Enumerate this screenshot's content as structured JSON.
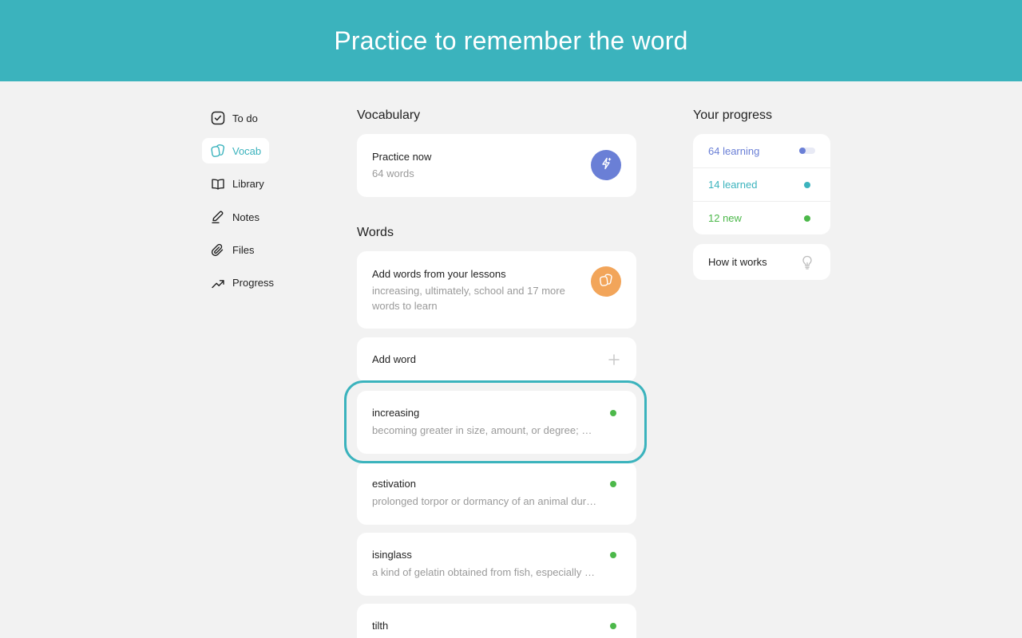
{
  "banner": {
    "title": "Practice to remember the word"
  },
  "nav": {
    "items": [
      {
        "label": "To do",
        "icon": "checkbox-icon"
      },
      {
        "label": "Vocab",
        "icon": "cards-icon",
        "active": true
      },
      {
        "label": "Library",
        "icon": "book-icon"
      },
      {
        "label": "Notes",
        "icon": "pencil-icon"
      },
      {
        "label": "Files",
        "icon": "paperclip-icon"
      },
      {
        "label": "Progress",
        "icon": "trend-up-icon"
      }
    ]
  },
  "vocabulary": {
    "title": "Vocabulary",
    "practice": {
      "title": "Practice now",
      "subtitle": "64 words",
      "icon": "lightning-icon",
      "color": "#6a7fd6"
    }
  },
  "words": {
    "title": "Words",
    "add_from_lessons": {
      "title": "Add words from your lessons",
      "subtitle": "increasing, ultimately, school and 17 more words to learn",
      "icon": "cards-icon",
      "color": "#f2a55a"
    },
    "add_word": {
      "label": "Add word",
      "icon": "plus-icon"
    },
    "list": [
      {
        "word": "increasing",
        "definition": "becoming greater in size, amount, or degree; growing"
      },
      {
        "word": "estivation",
        "definition": "prolonged torpor or dormancy of an animal during a hot or dry period"
      },
      {
        "word": "isinglass",
        "definition": "a kind of gelatin obtained from fish, especially sturgeon"
      },
      {
        "word": "tilth",
        "definition": ""
      }
    ]
  },
  "progress": {
    "title": "Your progress",
    "rows": [
      {
        "label": "64 learning",
        "color": "#6a7fd6"
      },
      {
        "label": "14 learned",
        "color": "#3bb3bd"
      },
      {
        "label": "12 new",
        "color": "#4cb84a"
      }
    ],
    "how_it_works": {
      "label": "How it works",
      "icon": "lightbulb-icon"
    }
  },
  "colors": {
    "accent": "#3bb3bd",
    "status_new": "#4cb84a"
  }
}
